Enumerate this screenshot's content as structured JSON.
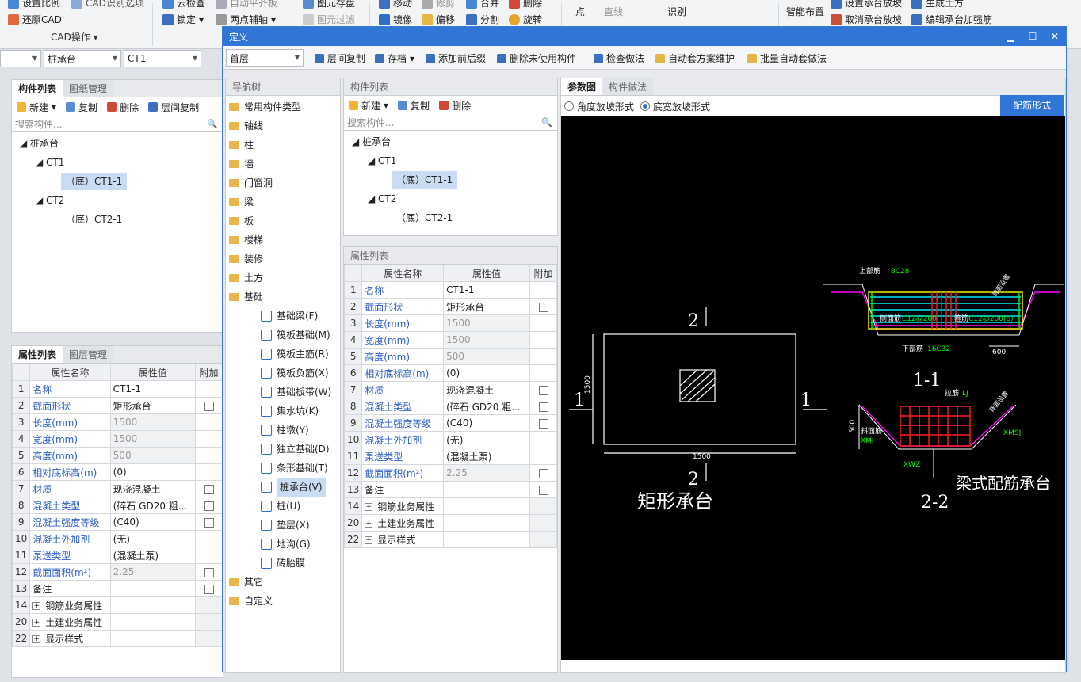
{
  "ribbon": {
    "row1": [
      "设置比例",
      "CAD识别选项",
      "云检查",
      "自动平齐板",
      "图元存盘",
      "移动",
      "修剪",
      "合并",
      "删除",
      "设置承台放坡",
      "生成土方"
    ],
    "restore_cad": "还原CAD",
    "group_cad": "CAD操作",
    "lock": "锁定",
    "two_point_axis": "两点辅轴",
    "filter": "图元过滤",
    "mirror": "镜像",
    "offset": "偏移",
    "split": "分割",
    "rotate": "旋转",
    "point": "点",
    "line": "直线",
    "identify": "识别",
    "pile_cap": "桩承台",
    "smart_layout": "智能布置",
    "cancel_slope": "取消承台放坡",
    "edit_reinf": "编辑承台加强筋"
  },
  "main": {
    "floor_select": "",
    "type_select": "桩承台",
    "name_select": "CT1",
    "tabs": [
      "构件列表",
      "图纸管理"
    ],
    "toolbar": {
      "new": "新建",
      "copy": "复制",
      "delete": "删除",
      "floor_copy": "层间复制"
    },
    "search_placeholder": "搜索构件...",
    "tree": [
      "桩承台",
      "CT1",
      "（底）CT1-1",
      "CT2",
      "（底）CT2-1"
    ],
    "prop_tabs": [
      "属性列表",
      "图层管理"
    ]
  },
  "props": {
    "headers": [
      "属性名称",
      "属性值",
      "附加"
    ],
    "rows": [
      {
        "no": "1",
        "name": "名称",
        "value": "CT1-1",
        "check": false,
        "blue": true,
        "grey": false
      },
      {
        "no": "2",
        "name": "截面形状",
        "value": "矩形承台",
        "check": true,
        "blue": true,
        "grey": false
      },
      {
        "no": "3",
        "name": "长度(mm)",
        "value": "1500",
        "check": false,
        "blue": true,
        "grey": true
      },
      {
        "no": "4",
        "name": "宽度(mm)",
        "value": "1500",
        "check": false,
        "blue": true,
        "grey": true
      },
      {
        "no": "5",
        "name": "高度(mm)",
        "value": "500",
        "check": false,
        "blue": true,
        "grey": true
      },
      {
        "no": "6",
        "name": "相对底标高(m)",
        "value": "(0)",
        "check": false,
        "blue": true,
        "grey": false
      },
      {
        "no": "7",
        "name": "材质",
        "value": "现浇混凝土",
        "check": true,
        "blue": true,
        "grey": false
      },
      {
        "no": "8",
        "name": "混凝土类型",
        "value": "(碎石 GD20 粗...",
        "check": true,
        "blue": true,
        "grey": false
      },
      {
        "no": "9",
        "name": "混凝土强度等级",
        "value": "(C40)",
        "check": true,
        "blue": true,
        "grey": false
      },
      {
        "no": "10",
        "name": "混凝土外加剂",
        "value": "(无)",
        "check": false,
        "blue": true,
        "grey": false
      },
      {
        "no": "11",
        "name": "泵送类型",
        "value": "(混凝土泵)",
        "check": false,
        "blue": true,
        "grey": false
      },
      {
        "no": "12",
        "name": "截面面积(m²)",
        "value": "2.25",
        "check": true,
        "blue": true,
        "grey": true
      },
      {
        "no": "13",
        "name": "备注",
        "value": "",
        "check": true,
        "blue": false,
        "grey": false
      },
      {
        "no": "14",
        "name": "钢筋业务属性",
        "value": "",
        "check": false,
        "blue": false,
        "grey": false,
        "group": true
      },
      {
        "no": "20",
        "name": "土建业务属性",
        "value": "",
        "check": false,
        "blue": false,
        "grey": false,
        "group": true
      },
      {
        "no": "22",
        "name": "显示样式",
        "value": "",
        "check": false,
        "blue": false,
        "grey": false,
        "group": true
      }
    ]
  },
  "dialog": {
    "title": "定义",
    "floor": "首层",
    "toolbar": [
      "层间复制",
      "存档",
      "添加前后缀",
      "删除未使用构件",
      "检查做法",
      "自动套方案维护",
      "批量自动套做法"
    ],
    "nav_title": "导航树",
    "nav_top": [
      "常用构件类型",
      "轴线",
      "柱",
      "墙",
      "门窗洞",
      "梁",
      "板",
      "楼梯",
      "装修",
      "土方",
      "基础"
    ],
    "nav_children": [
      "基础梁(F)",
      "筏板基础(M)",
      "筏板主筋(R)",
      "筏板负筋(X)",
      "基础板带(W)",
      "集水坑(K)",
      "柱墩(Y)",
      "独立基础(D)",
      "条形基础(T)",
      "桩承台(V)",
      "桩(U)",
      "垫层(X)",
      "地沟(G)",
      "砖胎膜"
    ],
    "nav_bottom": [
      "其它",
      "自定义"
    ],
    "comp_title": "构件列表",
    "prop_title": "属性列表",
    "right_tabs": [
      "参数图",
      "构件做法"
    ],
    "radio1": "角度放坡形式",
    "radio2": "底宽放坡形式",
    "rebar_btn": "配筋形式"
  },
  "drawing": {
    "title_rect": "矩形承台",
    "title_beam": "梁式配筋承台",
    "section11": "1-1",
    "section22": "2-2",
    "dim1500": "1500",
    "dim600": "600",
    "dim500": "500",
    "mark1": "1",
    "mark2": "2",
    "top_bar": "上部筋",
    "top_bar_val": "8C28",
    "side_bar": "侧面筋",
    "side_val": "C12@200",
    "bot_bar": "下部筋",
    "bot_val": "16C32",
    "hoop": "箍筋",
    "hoop_val": "C12@200(6)",
    "tie": "拉筋",
    "tie_val": "LJ",
    "slope_bar": "斜面筋",
    "xmj": "XMJ",
    "xmsj": "XMSJ",
    "xwz": "XWZ",
    "cover1": "背面设置",
    "cover2": "背面设置"
  }
}
